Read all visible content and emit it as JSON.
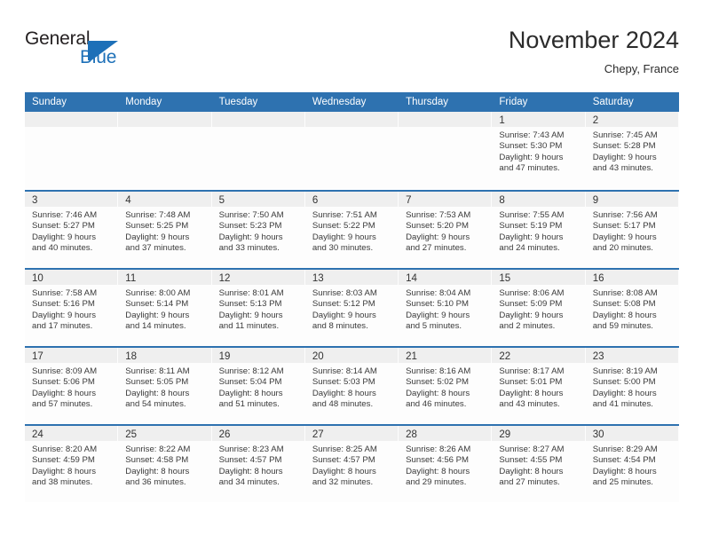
{
  "brand": {
    "name_part1": "General",
    "name_part2": "Blue",
    "logo_icon": "general-blue-flag-icon",
    "accent_color": "#1d70b8"
  },
  "header": {
    "title": "November 2024",
    "location": "Chepy, France"
  },
  "calendar": {
    "header_color": "#2e72b0",
    "day_band_color": "#efefef",
    "weekdays": [
      "Sunday",
      "Monday",
      "Tuesday",
      "Wednesday",
      "Thursday",
      "Friday",
      "Saturday"
    ],
    "weeks": [
      [
        {
          "day": "",
          "empty": true
        },
        {
          "day": "",
          "empty": true
        },
        {
          "day": "",
          "empty": true
        },
        {
          "day": "",
          "empty": true
        },
        {
          "day": "",
          "empty": true
        },
        {
          "day": "1",
          "sunrise": "Sunrise: 7:43 AM",
          "sunset": "Sunset: 5:30 PM",
          "daylight1": "Daylight: 9 hours",
          "daylight2": "and 47 minutes."
        },
        {
          "day": "2",
          "sunrise": "Sunrise: 7:45 AM",
          "sunset": "Sunset: 5:28 PM",
          "daylight1": "Daylight: 9 hours",
          "daylight2": "and 43 minutes."
        }
      ],
      [
        {
          "day": "3",
          "sunrise": "Sunrise: 7:46 AM",
          "sunset": "Sunset: 5:27 PM",
          "daylight1": "Daylight: 9 hours",
          "daylight2": "and 40 minutes."
        },
        {
          "day": "4",
          "sunrise": "Sunrise: 7:48 AM",
          "sunset": "Sunset: 5:25 PM",
          "daylight1": "Daylight: 9 hours",
          "daylight2": "and 37 minutes."
        },
        {
          "day": "5",
          "sunrise": "Sunrise: 7:50 AM",
          "sunset": "Sunset: 5:23 PM",
          "daylight1": "Daylight: 9 hours",
          "daylight2": "and 33 minutes."
        },
        {
          "day": "6",
          "sunrise": "Sunrise: 7:51 AM",
          "sunset": "Sunset: 5:22 PM",
          "daylight1": "Daylight: 9 hours",
          "daylight2": "and 30 minutes."
        },
        {
          "day": "7",
          "sunrise": "Sunrise: 7:53 AM",
          "sunset": "Sunset: 5:20 PM",
          "daylight1": "Daylight: 9 hours",
          "daylight2": "and 27 minutes."
        },
        {
          "day": "8",
          "sunrise": "Sunrise: 7:55 AM",
          "sunset": "Sunset: 5:19 PM",
          "daylight1": "Daylight: 9 hours",
          "daylight2": "and 24 minutes."
        },
        {
          "day": "9",
          "sunrise": "Sunrise: 7:56 AM",
          "sunset": "Sunset: 5:17 PM",
          "daylight1": "Daylight: 9 hours",
          "daylight2": "and 20 minutes."
        }
      ],
      [
        {
          "day": "10",
          "sunrise": "Sunrise: 7:58 AM",
          "sunset": "Sunset: 5:16 PM",
          "daylight1": "Daylight: 9 hours",
          "daylight2": "and 17 minutes."
        },
        {
          "day": "11",
          "sunrise": "Sunrise: 8:00 AM",
          "sunset": "Sunset: 5:14 PM",
          "daylight1": "Daylight: 9 hours",
          "daylight2": "and 14 minutes."
        },
        {
          "day": "12",
          "sunrise": "Sunrise: 8:01 AM",
          "sunset": "Sunset: 5:13 PM",
          "daylight1": "Daylight: 9 hours",
          "daylight2": "and 11 minutes."
        },
        {
          "day": "13",
          "sunrise": "Sunrise: 8:03 AM",
          "sunset": "Sunset: 5:12 PM",
          "daylight1": "Daylight: 9 hours",
          "daylight2": "and 8 minutes."
        },
        {
          "day": "14",
          "sunrise": "Sunrise: 8:04 AM",
          "sunset": "Sunset: 5:10 PM",
          "daylight1": "Daylight: 9 hours",
          "daylight2": "and 5 minutes."
        },
        {
          "day": "15",
          "sunrise": "Sunrise: 8:06 AM",
          "sunset": "Sunset: 5:09 PM",
          "daylight1": "Daylight: 9 hours",
          "daylight2": "and 2 minutes."
        },
        {
          "day": "16",
          "sunrise": "Sunrise: 8:08 AM",
          "sunset": "Sunset: 5:08 PM",
          "daylight1": "Daylight: 8 hours",
          "daylight2": "and 59 minutes."
        }
      ],
      [
        {
          "day": "17",
          "sunrise": "Sunrise: 8:09 AM",
          "sunset": "Sunset: 5:06 PM",
          "daylight1": "Daylight: 8 hours",
          "daylight2": "and 57 minutes."
        },
        {
          "day": "18",
          "sunrise": "Sunrise: 8:11 AM",
          "sunset": "Sunset: 5:05 PM",
          "daylight1": "Daylight: 8 hours",
          "daylight2": "and 54 minutes."
        },
        {
          "day": "19",
          "sunrise": "Sunrise: 8:12 AM",
          "sunset": "Sunset: 5:04 PM",
          "daylight1": "Daylight: 8 hours",
          "daylight2": "and 51 minutes."
        },
        {
          "day": "20",
          "sunrise": "Sunrise: 8:14 AM",
          "sunset": "Sunset: 5:03 PM",
          "daylight1": "Daylight: 8 hours",
          "daylight2": "and 48 minutes."
        },
        {
          "day": "21",
          "sunrise": "Sunrise: 8:16 AM",
          "sunset": "Sunset: 5:02 PM",
          "daylight1": "Daylight: 8 hours",
          "daylight2": "and 46 minutes."
        },
        {
          "day": "22",
          "sunrise": "Sunrise: 8:17 AM",
          "sunset": "Sunset: 5:01 PM",
          "daylight1": "Daylight: 8 hours",
          "daylight2": "and 43 minutes."
        },
        {
          "day": "23",
          "sunrise": "Sunrise: 8:19 AM",
          "sunset": "Sunset: 5:00 PM",
          "daylight1": "Daylight: 8 hours",
          "daylight2": "and 41 minutes."
        }
      ],
      [
        {
          "day": "24",
          "sunrise": "Sunrise: 8:20 AM",
          "sunset": "Sunset: 4:59 PM",
          "daylight1": "Daylight: 8 hours",
          "daylight2": "and 38 minutes."
        },
        {
          "day": "25",
          "sunrise": "Sunrise: 8:22 AM",
          "sunset": "Sunset: 4:58 PM",
          "daylight1": "Daylight: 8 hours",
          "daylight2": "and 36 minutes."
        },
        {
          "day": "26",
          "sunrise": "Sunrise: 8:23 AM",
          "sunset": "Sunset: 4:57 PM",
          "daylight1": "Daylight: 8 hours",
          "daylight2": "and 34 minutes."
        },
        {
          "day": "27",
          "sunrise": "Sunrise: 8:25 AM",
          "sunset": "Sunset: 4:57 PM",
          "daylight1": "Daylight: 8 hours",
          "daylight2": "and 32 minutes."
        },
        {
          "day": "28",
          "sunrise": "Sunrise: 8:26 AM",
          "sunset": "Sunset: 4:56 PM",
          "daylight1": "Daylight: 8 hours",
          "daylight2": "and 29 minutes."
        },
        {
          "day": "29",
          "sunrise": "Sunrise: 8:27 AM",
          "sunset": "Sunset: 4:55 PM",
          "daylight1": "Daylight: 8 hours",
          "daylight2": "and 27 minutes."
        },
        {
          "day": "30",
          "sunrise": "Sunrise: 8:29 AM",
          "sunset": "Sunset: 4:54 PM",
          "daylight1": "Daylight: 8 hours",
          "daylight2": "and 25 minutes."
        }
      ]
    ]
  }
}
